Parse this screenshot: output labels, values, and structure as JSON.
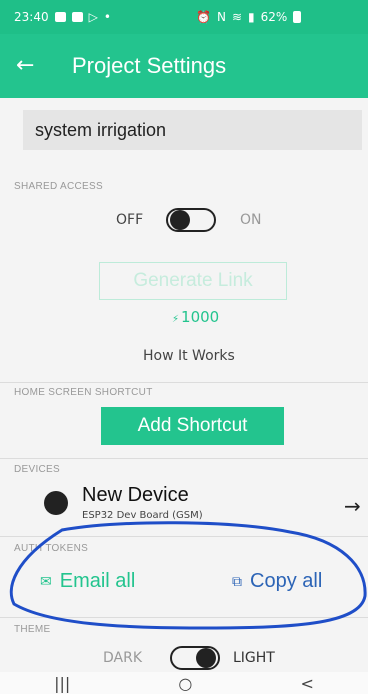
{
  "status": {
    "time": "23:40",
    "battery": "62%"
  },
  "header": {
    "title": "Project Settings"
  },
  "project": {
    "name": "system irrigation"
  },
  "shared_access": {
    "label": "SHARED ACCESS",
    "off": "OFF",
    "on": "ON",
    "generate_link": "Generate Link",
    "energy": "1000",
    "how_it_works": "How It Works"
  },
  "home_shortcut": {
    "label": "HOME SCREEN SHORTCUT",
    "button": "Add Shortcut"
  },
  "devices": {
    "label": "DEVICES",
    "name": "New Device",
    "subtitle": "ESP32 Dev Board (GSM)"
  },
  "auth_tokens": {
    "label": "AUTH TOKENS",
    "email_all": "Email all",
    "copy_all": "Copy all"
  },
  "theme": {
    "label": "THEME",
    "dark": "DARK",
    "light": "LIGHT"
  },
  "nav": {
    "recents": "|||",
    "home": "○",
    "back": "<"
  },
  "colors": {
    "accent": "#23c48e",
    "annotation": "#2c64b6"
  }
}
